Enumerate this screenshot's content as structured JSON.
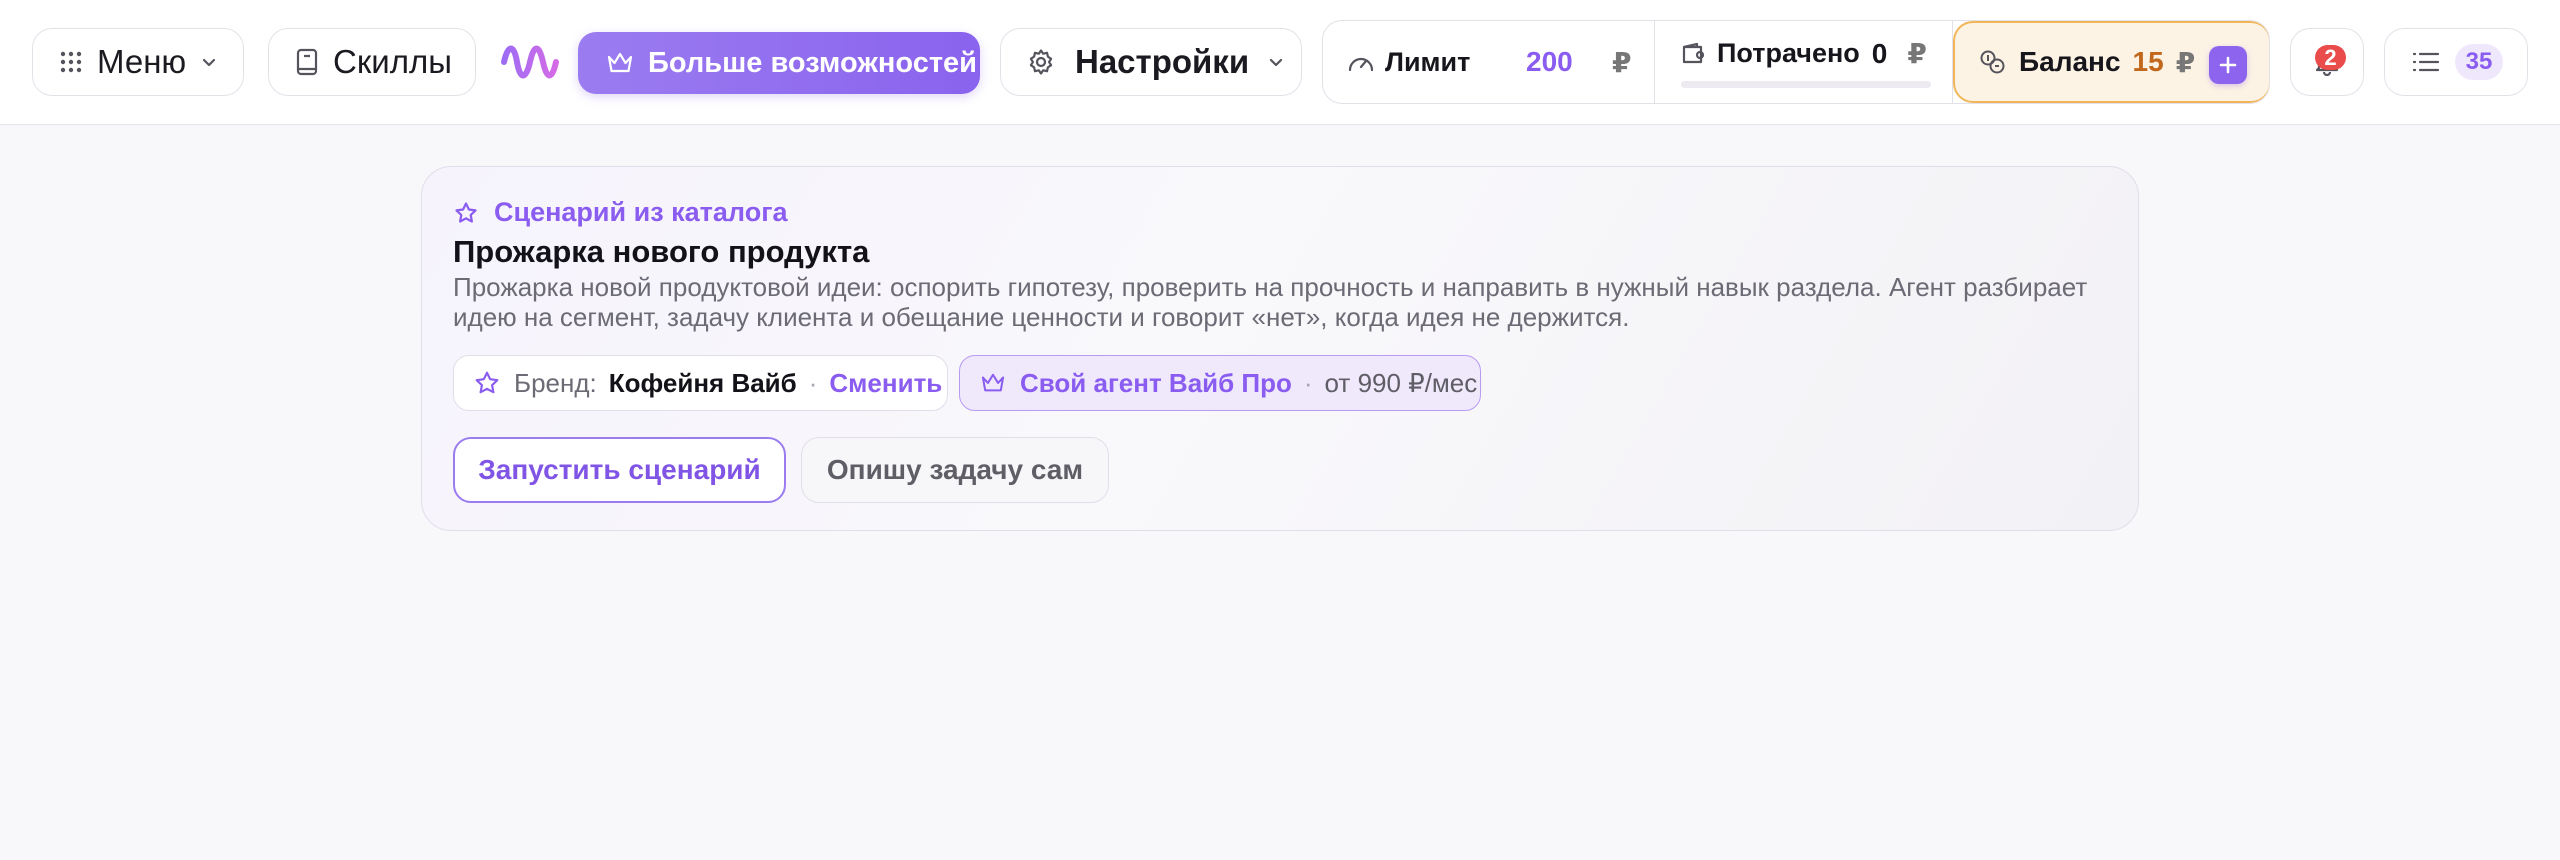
{
  "header": {
    "menu_label": "Меню",
    "skills_label": "Скиллы",
    "more_label": "Больше возможностей",
    "settings_label": "Настройки",
    "stats": {
      "limit_label": "Лимит",
      "limit_value": "200",
      "limit_currency": "₽",
      "spent_label": "Потрачено",
      "spent_value": "0",
      "spent_currency": "₽",
      "spent_fraction": 0,
      "balance_label": "Баланс",
      "balance_value": "15",
      "balance_currency": "₽"
    },
    "notifications_count": "2",
    "tasks_count": "35"
  },
  "scenario": {
    "kicker": "Сценарий из каталога",
    "title": "Прожарка нового продукта",
    "description": "Прожарка новой продуктовой идеи: оспорить гипотезу, проверить на прочность и направить в нужный навык раздела. Агент разбирает идею на сегмент, задачу клиента и обещание ценности и говорит «нет», когда идея не держится.",
    "brand_chip": {
      "label": "Бренд:",
      "value": "Кофейня Вайб",
      "separator": "·",
      "action": "Сменить"
    },
    "pro_chip": {
      "label": "Свой агент Вайб Про",
      "separator": "·",
      "price": "от 990 ₽/мес"
    },
    "run_button": "Запустить сценарий",
    "self_button": "Опишу задачу сам"
  },
  "colors": {
    "accent": "#8a5cf0",
    "balance_bg": "#fdf3e4",
    "balance_border": "#f2b65a",
    "balance_value": "#c2681c",
    "badge_red": "#ea4b4b"
  },
  "icons": {
    "menu": "grid-dots-icon",
    "skills": "book-icon",
    "logo": "wave-logo",
    "more": "crown-icon",
    "settings": "gear-icon",
    "limit": "speedometer-icon",
    "spent": "wallet-icon",
    "balance": "coins-icon",
    "topup": "plus-icon",
    "notifications": "bell-icon",
    "tasks": "list-icon",
    "kicker": "star-icon"
  }
}
